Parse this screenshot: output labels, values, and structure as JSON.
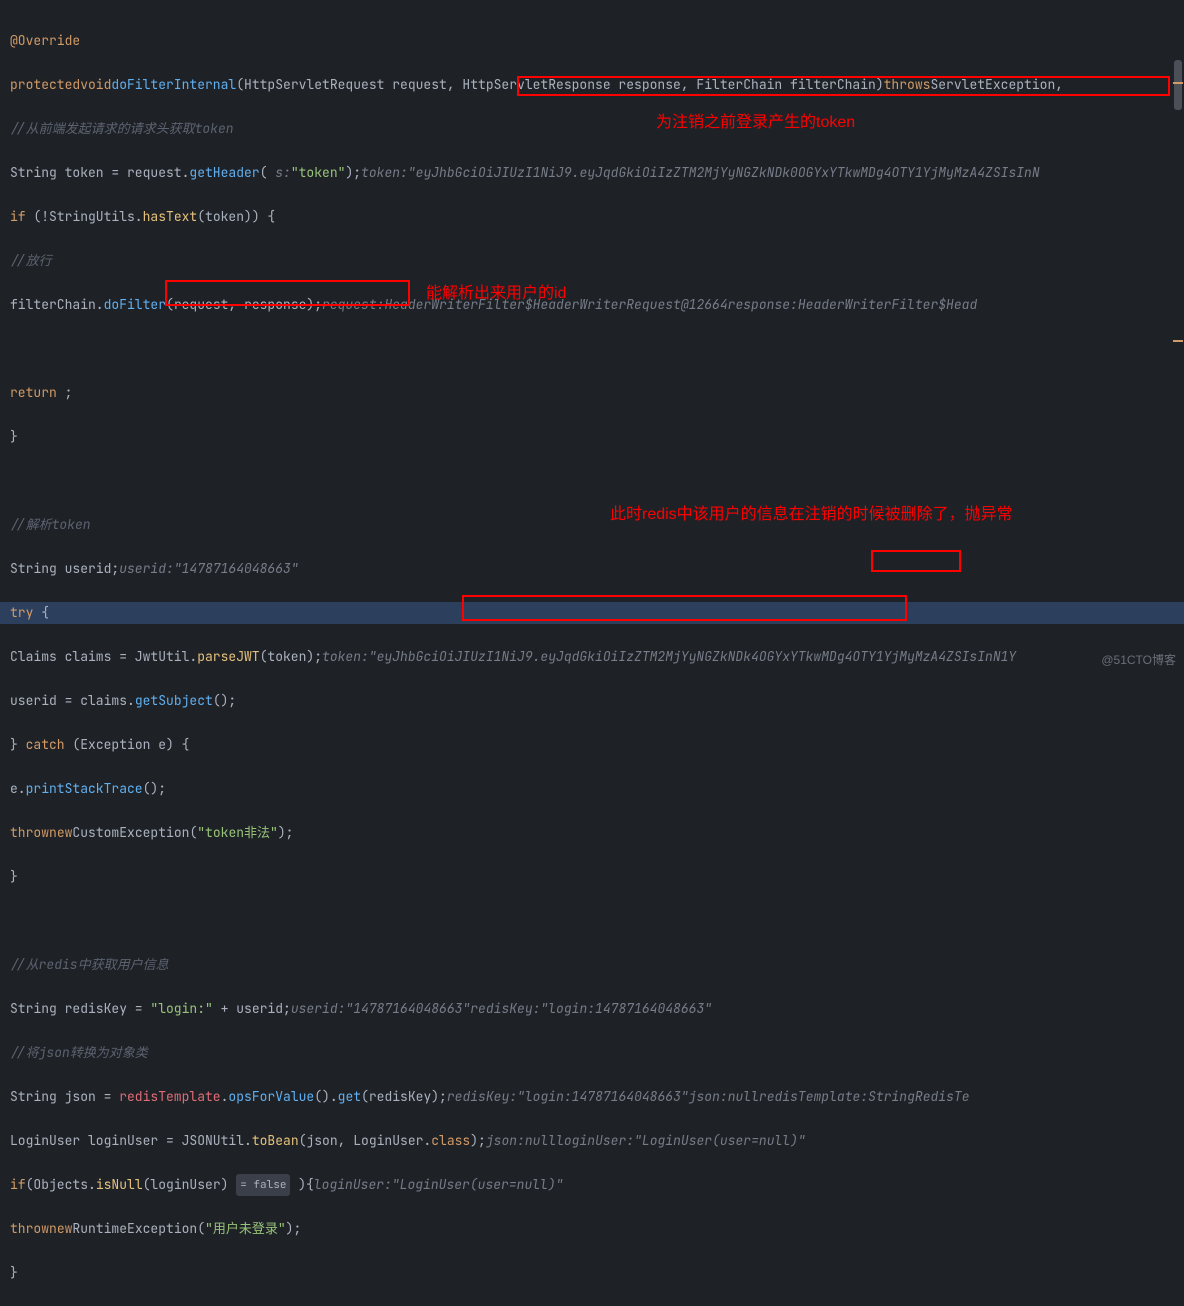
{
  "code": {
    "l1": {
      "annotation": "@Override"
    },
    "l2": {
      "kw1": "protected",
      "kw2": "void",
      "method": "doFilterInternal",
      "params": "(HttpServletRequest request, HttpServletResponse response, FilterChain filterChain)",
      "throws": "throws",
      "exc": "ServletException,"
    },
    "l3": {
      "comment": "//从前端发起请求的请求头获取token"
    },
    "l4": {
      "text1": "String token = request.",
      "method": "getHeader",
      "text2": "( ",
      "pname": "s:",
      "pval": "\"token\"",
      "text3": ");",
      "hint_l": "token:",
      "hint_v": "\"eyJhbGciOiJIUzI1NiJ9.eyJqdGkiOiIzZTM2MjYyNGZkNDk0OGYxYTkwMDg4OTY1YjMyMzA4ZSIsInN"
    },
    "l5": {
      "kw": "if",
      "text": " (!StringUtils.",
      "method": "hasText",
      "text2": "(token)) {"
    },
    "l6": {
      "comment": "//放行"
    },
    "l7": {
      "text": "filterChain.",
      "method": "doFilter",
      "text2": "(request, response);",
      "h1l": "request:",
      "h1v": "HeaderWriterFilter$HeaderWriterRequest@12664",
      "h2l": "response:",
      "h2v": "HeaderWriterFilter$Head"
    },
    "l8": {},
    "l9": {
      "kw": "return",
      "text": " ;"
    },
    "l10": {
      "brace": "}"
    },
    "l11": {},
    "l12": {
      "comment": "//解析token"
    },
    "l13": {
      "text": "String userid;",
      "hl": "userid:",
      "hv": "\"14787164048663\""
    },
    "l14": {
      "kw": "try",
      "text": " {"
    },
    "l15": {
      "text": "Claims claims = JwtUtil.",
      "method": "parseJWT",
      "text2": "(token);",
      "hl": "token:",
      "hv": "\"eyJhbGciOiJIUzI1NiJ9.eyJqdGkiOiIzZTM2MjYyNGZkNDk4OGYxYTkwMDg4OTY1YjMyMzA4ZSIsInN1Y"
    },
    "l16": {
      "text": "userid = claims.",
      "method": "getSubject",
      "text2": "();"
    },
    "l17": {
      "brace": "} ",
      "kw": "catch",
      "text": " (Exception e) {"
    },
    "l18": {
      "text": "e.",
      "method": "printStackTrace",
      "text2": "();"
    },
    "l19": {
      "kw1": "throw",
      "kw2": "new",
      "cls": "CustomException",
      "text": "(",
      "str": "\"token非法\"",
      "text2": ");"
    },
    "l20": {
      "brace": "}"
    },
    "l21": {},
    "l22": {
      "comment": "//从redis中获取用户信息"
    },
    "l23": {
      "text": "String redisKey = ",
      "str": "\"login:\"",
      "text2": " + userid;",
      "h1l": "userid:",
      "h1v": "\"14787164048663\"",
      "h2l": "redisKey:",
      "h2v": "\"login:14787164048663\""
    },
    "l24": {
      "comment": "//将json转换为对象类"
    },
    "l25": {
      "text": "String json = ",
      "field": "redisTemplate",
      "text2": ".",
      "method": "opsForValue",
      "text3": "().",
      "method2": "get",
      "text4": "(redisKey);",
      "h1l": "redisKey:",
      "h1v": "\"login:14787164048663\"",
      "h2l": "json:",
      "h2v": "null",
      "h3l": "redisTemplate:",
      "h3v": "StringRedisTe"
    },
    "l26": {
      "text": "LoginUser loginUser = JSONUtil.",
      "method": "toBean",
      "text2": "(json, LoginUser.",
      "kw": "class",
      "text3": ");",
      "h1l": "json:",
      "h1v": "null",
      "h2l": "loginUser:",
      "h2v": "\"LoginUser(user=null)\""
    },
    "l27": {
      "kw": "if",
      "text": "(Objects.",
      "method": "isNull",
      "text2": "(loginUser) ",
      "badge": "= false",
      "text3": " ){",
      "hl": "loginUser:",
      "hv": "\"LoginUser(user=null)\""
    },
    "l28": {
      "kw1": "throw",
      "kw2": "new",
      "cls": "RuntimeException",
      "text": "(",
      "str": "\"用户未登录\"",
      "text2": ");"
    },
    "l29": {
      "brace": "}"
    }
  },
  "annotations": {
    "label1": "为注销之前登录产生的token",
    "label2": "能解析出来用户的id",
    "label3": "此时redis中该用户的信息在注销的时候被删除了，抛异常"
  },
  "watermark": "@51CTO博客"
}
